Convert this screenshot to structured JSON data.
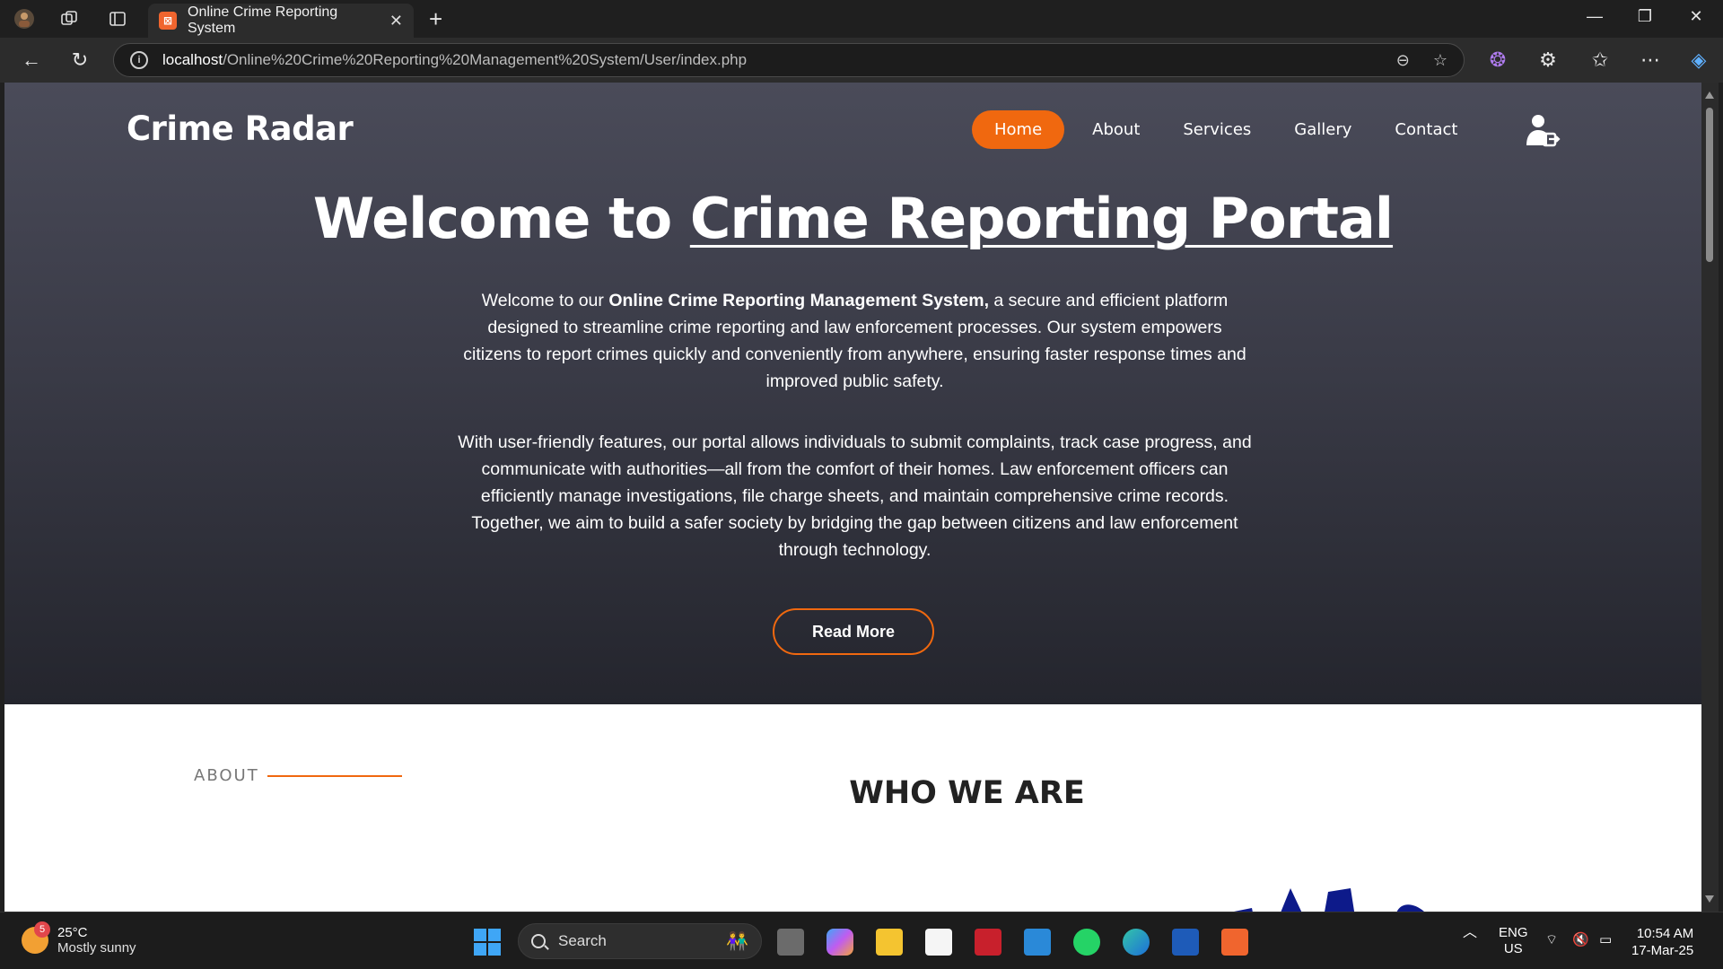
{
  "browser": {
    "tab_title": "Online Crime Reporting System",
    "tab_close": "✕",
    "new_tab": "+",
    "url_host": "localhost",
    "url_path": "/Online%20Crime%20Reporting%20Management%20System/User/index.php",
    "window_controls": [
      "—",
      "❐",
      "✕"
    ]
  },
  "site": {
    "brand": "Crime Radar",
    "nav": [
      {
        "label": "Home",
        "active": true
      },
      {
        "label": "About"
      },
      {
        "label": "Services"
      },
      {
        "label": "Gallery"
      },
      {
        "label": "Contact"
      }
    ],
    "hero": {
      "title_plain": "Welcome to ",
      "title_underlined": "Crime Reporting Portal",
      "para1_a": "Welcome to our ",
      "para1_bold": "Online Crime Reporting Management System,",
      "para1_b": " a secure and efficient platform designed to streamline crime reporting and law enforcement processes. Our system empowers citizens to report crimes quickly and conveniently from anywhere, ensuring faster response times and improved public safety.",
      "para2": "With user-friendly features, our portal allows individuals to submit complaints, track case progress, and communicate with authorities—all from the comfort of their homes. Law enforcement officers can efficiently manage investigations, file charge sheets, and maintain comprehensive crime records. Together, we aim to build a safer society by bridging the gap between citizens and law enforcement through technology.",
      "read_more": "Read More"
    },
    "about": {
      "label": "ABOUT",
      "heading": "WHO WE ARE"
    },
    "accent_color": "#f0680f"
  },
  "taskbar": {
    "temperature": "25°C",
    "weather": "Mostly sunny",
    "weather_badge": "5",
    "search": "Search",
    "lang_top": "ENG",
    "lang_bottom": "US",
    "time": "10:54 AM",
    "date": "17-Mar-25"
  }
}
